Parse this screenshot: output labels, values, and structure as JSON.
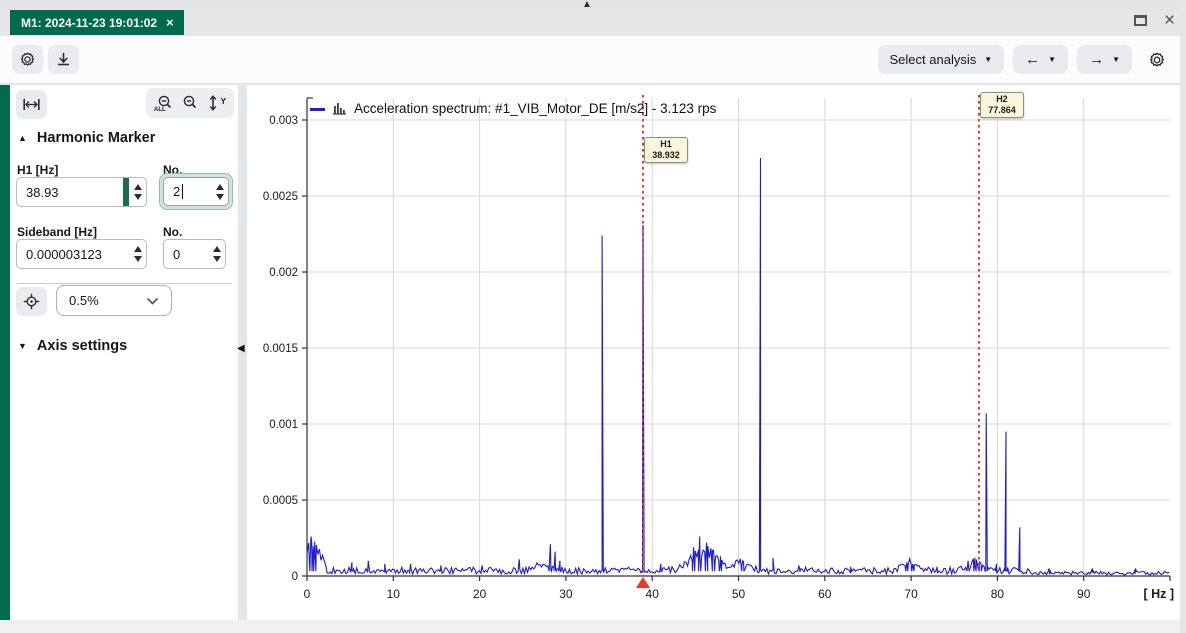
{
  "tab": {
    "title": "M1: 2024-11-23 19:01:02",
    "close_glyph": "×"
  },
  "window": {
    "resize_handle_glyph": "▲",
    "close_glyph": "×"
  },
  "toolbar": {
    "select_analysis": "Select analysis",
    "prev_glyph": "←",
    "next_glyph": "→",
    "caret_glyph": "▼"
  },
  "panel": {
    "harmonic_header": "Harmonic Marker",
    "harmonic_tri": "▲",
    "h1_label": "H1 [Hz]",
    "h1_value": "38.93",
    "no1_label": "No.",
    "no1_value": "2",
    "sideband_label": "Sideband [Hz]",
    "sideband_value": "0.000003123",
    "no2_label": "No.",
    "no2_value": "0",
    "tolerance_value": "0.5%",
    "axis_header": "Axis settings",
    "axis_tri": "▼",
    "zoom_all_caption": "ALL",
    "autoscale_caption": "Y",
    "collapse_glyph": "◀"
  },
  "colors": {
    "accent_green": "#006b4c",
    "input_green": "#17724a",
    "line_blue": "#1d1dce",
    "marker_red": "#e8392f",
    "grid_gray": "#d7d7d7",
    "label_beige": "#faf6dc"
  },
  "chart_data": {
    "type": "line",
    "title": "Acceleration spectrum: #1_VIB_Motor_DE [m/s2] - 3.123 rps",
    "x_unit": "[ Hz ]",
    "x_min": 0,
    "x_max": 100,
    "y_min": 0,
    "y_max": 0.003,
    "grid": true,
    "x_ticks": [
      0,
      10,
      20,
      30,
      40,
      50,
      60,
      70,
      80,
      90
    ],
    "y_ticks": [
      {
        "v": 0.003,
        "label": "0.003"
      },
      {
        "v": 0.0025,
        "label": "0.0025"
      },
      {
        "v": 0.002,
        "label": "0.002"
      },
      {
        "v": 0.0015,
        "label": "0.0015"
      },
      {
        "v": 0.001,
        "label": "0.001"
      },
      {
        "v": 0.0005,
        "label": "0.0005"
      },
      {
        "v": 0,
        "label": "0"
      }
    ],
    "noise_floor": 3.5e-05,
    "peaks": [
      {
        "hz": 0.45,
        "amp": 0.00026
      },
      {
        "hz": 0.9,
        "amp": 0.00019
      },
      {
        "hz": 5.2,
        "amp": 9e-05
      },
      {
        "hz": 7.1,
        "amp": 0.0001
      },
      {
        "hz": 9.0,
        "amp": 8e-05
      },
      {
        "hz": 12.0,
        "amp": 8e-05
      },
      {
        "hz": 15.5,
        "amp": 7e-05
      },
      {
        "hz": 20.3,
        "amp": 7e-05
      },
      {
        "hz": 24.6,
        "amp": 0.00011
      },
      {
        "hz": 28.2,
        "amp": 0.00021
      },
      {
        "hz": 28.75,
        "amp": 0.00016
      },
      {
        "hz": 29.3,
        "amp": 0.0001
      },
      {
        "hz": 34.2,
        "amp": 0.00224
      },
      {
        "hz": 38.932,
        "amp": 0.00231
      },
      {
        "hz": 41.0,
        "amp": 8e-05
      },
      {
        "hz": 44.8,
        "amp": 0.00019
      },
      {
        "hz": 45.5,
        "amp": 0.00026
      },
      {
        "hz": 46.3,
        "amp": 0.00022
      },
      {
        "hz": 47.1,
        "amp": 0.00017
      },
      {
        "hz": 47.9,
        "amp": 0.00013
      },
      {
        "hz": 50.5,
        "amp": 0.0001
      },
      {
        "hz": 52.55,
        "amp": 0.00275
      },
      {
        "hz": 54.0,
        "amp": 0.00012
      },
      {
        "hz": 57.0,
        "amp": 7e-05
      },
      {
        "hz": 63.0,
        "amp": 6e-05
      },
      {
        "hz": 69.5,
        "amp": 9e-05
      },
      {
        "hz": 70.2,
        "amp": 8e-05
      },
      {
        "hz": 73.0,
        "amp": 6e-05
      },
      {
        "hz": 76.6,
        "amp": 0.0001
      },
      {
        "hz": 77.4,
        "amp": 0.00012
      },
      {
        "hz": 78.0,
        "amp": 9e-05
      },
      {
        "hz": 78.7,
        "amp": 0.00107
      },
      {
        "hz": 79.9,
        "amp": 8e-05
      },
      {
        "hz": 81.0,
        "amp": 0.00095
      },
      {
        "hz": 82.6,
        "amp": 0.00032
      },
      {
        "hz": 86.0,
        "amp": 5e-05
      },
      {
        "hz": 91.0,
        "amp": 5e-05
      },
      {
        "hz": 96.0,
        "amp": 5e-05
      }
    ],
    "bumps": [
      {
        "hz": 1.0,
        "w": 0.9,
        "amp": 9e-05
      },
      {
        "hz": 27.6,
        "w": 1.4,
        "amp": 4e-05
      },
      {
        "hz": 46.0,
        "w": 2.1,
        "amp": 0.00012
      },
      {
        "hz": 50.5,
        "w": 1.1,
        "amp": 5e-05
      },
      {
        "hz": 70.0,
        "w": 1.4,
        "amp": 4e-05
      },
      {
        "hz": 77.4,
        "w": 1.1,
        "amp": 5e-05
      }
    ],
    "markers": [
      {
        "label": "H1",
        "value": "38.932",
        "hz": 38.932
      },
      {
        "label": "H2",
        "value": "77.864",
        "hz": 77.864
      }
    ],
    "triangle_hz": 38.932,
    "legend_position": "top-left"
  }
}
